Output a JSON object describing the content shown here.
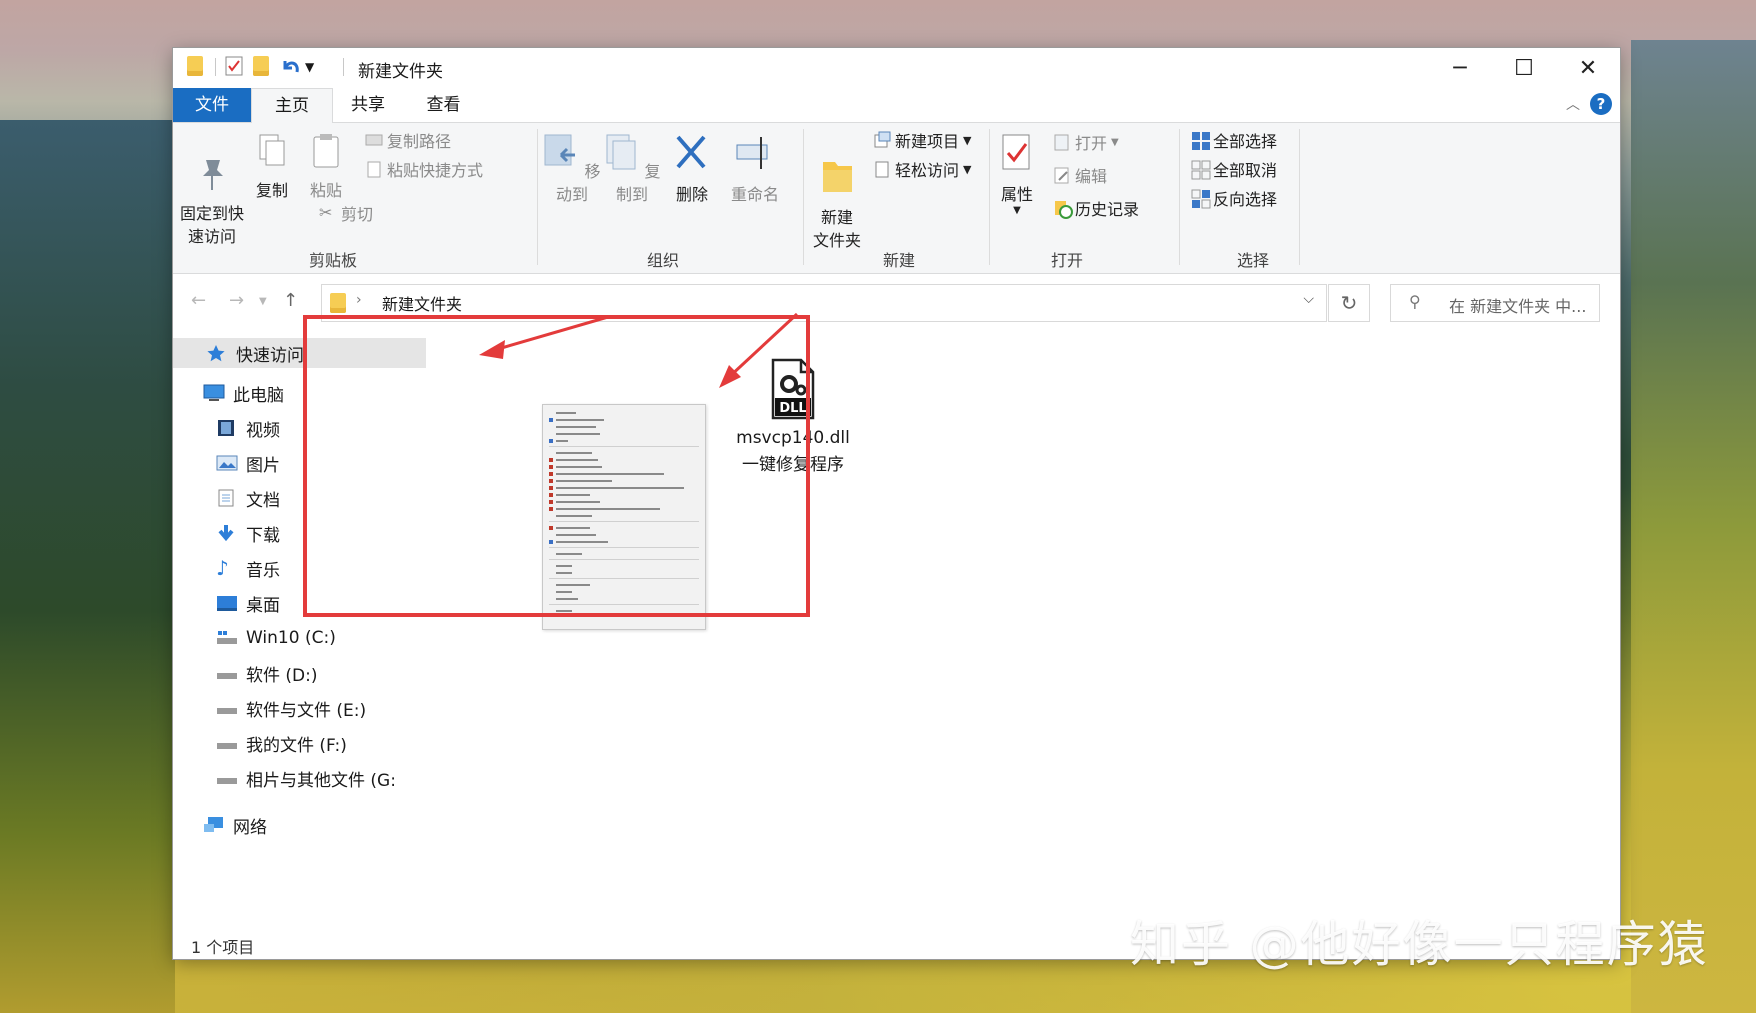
{
  "window": {
    "title": "新建文件夹",
    "controls": {
      "minimize": "─",
      "maximize": "☐",
      "close": "✕"
    }
  },
  "ribbon_tabs": [
    "文件",
    "主页",
    "共享",
    "查看"
  ],
  "ribbon": {
    "clipboard": {
      "pin": "固定到快\n速访问",
      "copy": "复制",
      "paste": "粘贴",
      "copy_path": "复制路径",
      "paste_shortcut": "粘贴快捷方式",
      "cut": "剪切",
      "label": "剪贴板"
    },
    "organize": {
      "move_to": "移动到",
      "copy_to": "复制到",
      "delete": "删除",
      "rename": "重命名",
      "label": "组织"
    },
    "new": {
      "new_folder": "新建\n文件夹",
      "new_item": "新建项目",
      "easy_access": "轻松访问",
      "label": "新建"
    },
    "open": {
      "properties": "属性",
      "open": "打开",
      "edit": "编辑",
      "history": "历史记录",
      "label": "打开"
    },
    "select": {
      "select_all": "全部选择",
      "select_none": "全部取消",
      "invert": "反向选择",
      "label": "选择"
    }
  },
  "address": {
    "crumb": "新建文件夹",
    "search_placeholder": "在 新建文件夹 中..."
  },
  "nav_pane": [
    {
      "label": "快速访问",
      "icon": "star-icon",
      "selected": true
    },
    {
      "label": "此电脑",
      "icon": "computer-icon"
    },
    {
      "label": "视频",
      "icon": "video-icon"
    },
    {
      "label": "图片",
      "icon": "pictures-icon"
    },
    {
      "label": "文档",
      "icon": "documents-icon"
    },
    {
      "label": "下载",
      "icon": "download-icon"
    },
    {
      "label": "音乐",
      "icon": "music-icon"
    },
    {
      "label": "桌面",
      "icon": "desktop-icon"
    },
    {
      "label": "Win10 (C:)",
      "icon": "system-drive-icon"
    },
    {
      "label": "软件 (D:)",
      "icon": "drive-icon"
    },
    {
      "label": "软件与文件 (E:)",
      "icon": "drive-icon"
    },
    {
      "label": "我的文件 (F:)",
      "icon": "drive-icon"
    },
    {
      "label": "相片与其他文件 (G:",
      "icon": "drive-icon"
    },
    {
      "label": "网络",
      "icon": "network-icon"
    }
  ],
  "files": [
    {
      "name": "msvcp140.dll",
      "icon_label": "DLL"
    }
  ],
  "annotation_text": "一键修复程序",
  "status": "1 个项目",
  "watermark": "知乎 @他好像一只程序猿",
  "colors": {
    "accent": "#1a6dc2",
    "highlight": "#e33b3b"
  }
}
